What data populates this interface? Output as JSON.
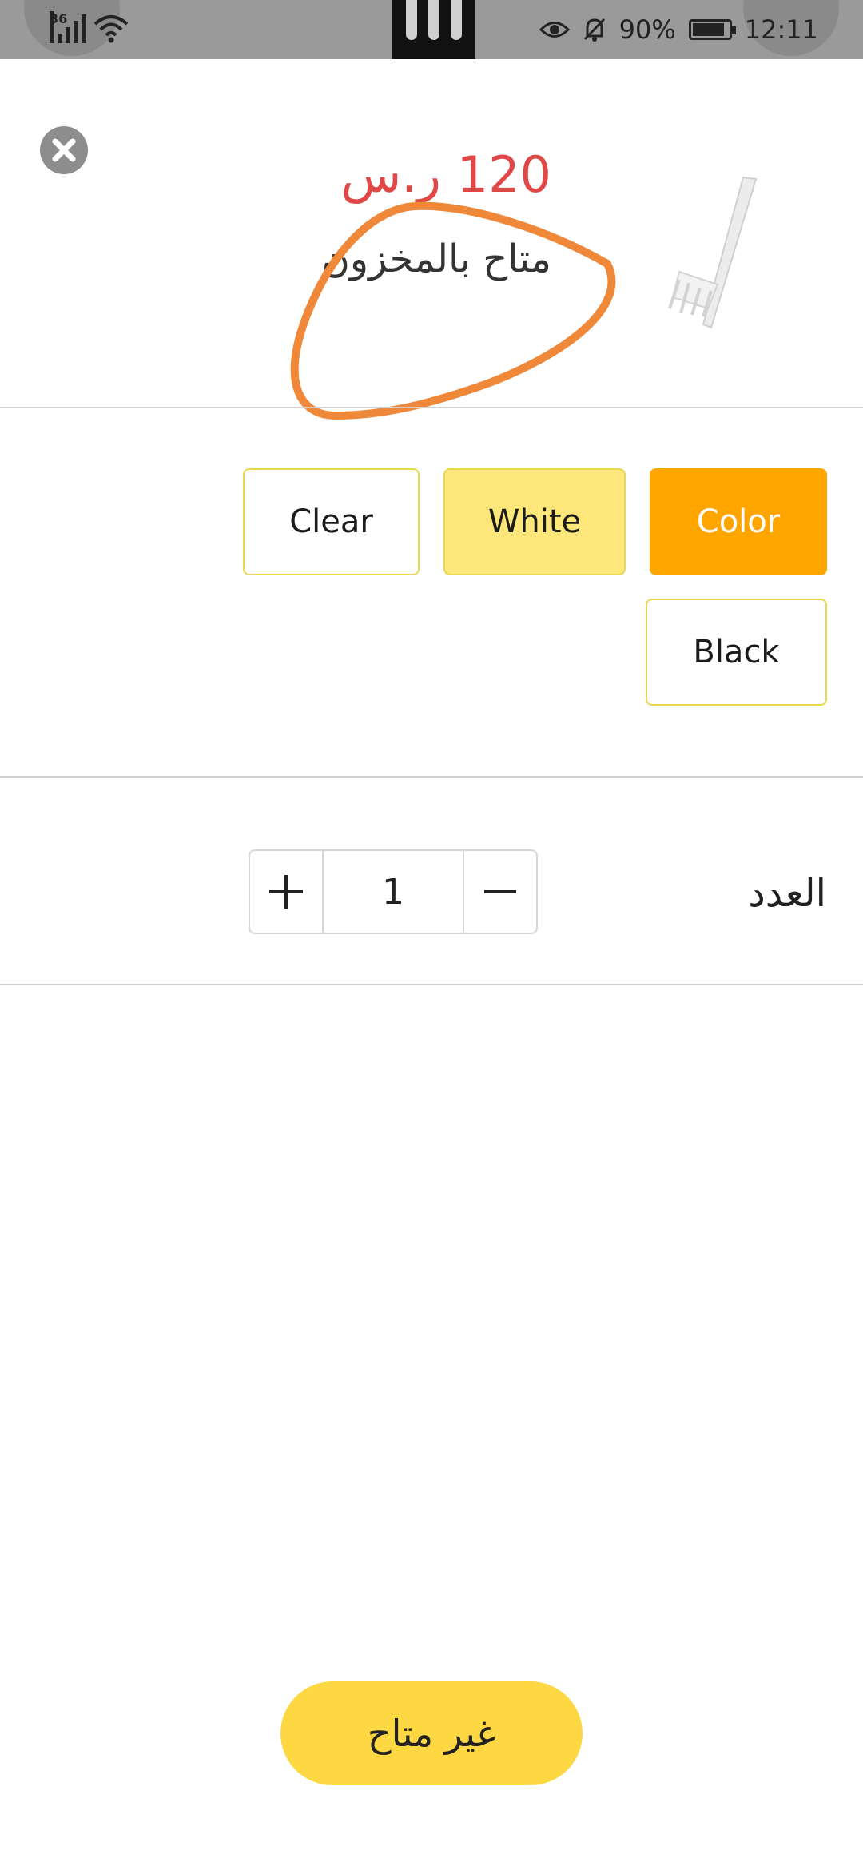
{
  "status_bar": {
    "network": "36",
    "battery": "90%",
    "time": "12:11",
    "icons": [
      "signal-icon",
      "wifi-icon",
      "eye-icon",
      "bell-off-icon",
      "battery-icon"
    ]
  },
  "product": {
    "price": "120 ر.س",
    "stock_status": "متاح بالمخزون",
    "image_icon": "fork-icon"
  },
  "options": [
    {
      "label": "Color"
    },
    {
      "label": "White"
    },
    {
      "label": "Clear"
    },
    {
      "label": "Black"
    }
  ],
  "quantity": {
    "label": "العدد",
    "value": "1"
  },
  "cta": {
    "label": "غير متاح"
  },
  "colors": {
    "accent_active": "#ffa500",
    "accent_selected": "#fde67a",
    "cta": "#fdd842",
    "price": "#e04848",
    "annotation": "#f0883a"
  }
}
